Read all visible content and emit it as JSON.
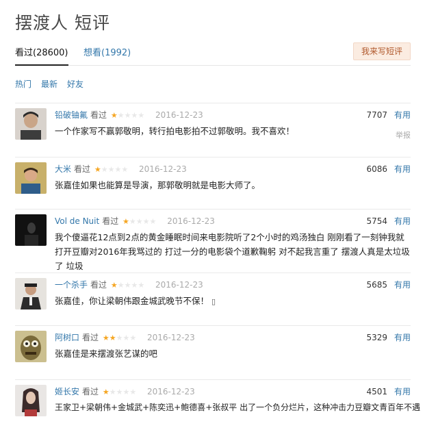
{
  "page": {
    "title": "摆渡人 短评"
  },
  "tabs": {
    "watched": "看过(28600)",
    "want": "想看(1992)"
  },
  "write_button": "我来写短评",
  "sort": [
    "热门",
    "最新",
    "好友"
  ],
  "colors": {
    "link": "#3377aa",
    "star": "#f5a623",
    "button_bg": "#fbece1"
  },
  "reviews": [
    {
      "user": "铅破铀氟",
      "action": "看过",
      "rating": 1,
      "date": "2016-12-23",
      "votes": "7707",
      "useful": "有用",
      "report": "举报",
      "content": "一个作家写不赢郭敬明，转行拍电影拍不过郭敬明。我不喜欢！"
    },
    {
      "user": "大米",
      "action": "看过",
      "rating": 1,
      "date": "2016-12-23",
      "votes": "6086",
      "useful": "有用",
      "content": "张嘉佳如果也能算是导演，那郭敬明就是电影大师了。"
    },
    {
      "user": "Vol de Nuit",
      "action": "看过",
      "rating": 1,
      "date": "2016-12-23",
      "votes": "5754",
      "useful": "有用",
      "content": "我个傻逼花12点到2点的黄金睡眠时间来电影院听了2个小时的鸡汤独白 刚刚看了一刻钟我就打开豆瓣对2016年我骂过的 打过一分的电影袋个道歉鞠躬 对不起我言重了 摆渡人真是太垃圾了 垃圾"
    },
    {
      "user": "一个杀手",
      "action": "看过",
      "rating": 1,
      "date": "2016-12-23",
      "votes": "5685",
      "useful": "有用",
      "content": "张嘉佳，你让梁朝伟跟金城武晚节不保！"
    },
    {
      "user": "阿树口",
      "action": "看过",
      "rating": 2,
      "date": "2016-12-23",
      "votes": "5329",
      "useful": "有用",
      "content": "张嘉佳是来摆渡张艺谋的吧"
    },
    {
      "user": "姬长安",
      "action": "看过",
      "rating": 1,
      "date": "2016-12-23",
      "votes": "4501",
      "useful": "有用",
      "content": "王家卫+梁朝伟+金城武+陈奕迅+鲍德喜+张叔平 出了一个负分烂片，这种冲击力豆瓣文青百年不遇"
    }
  ]
}
